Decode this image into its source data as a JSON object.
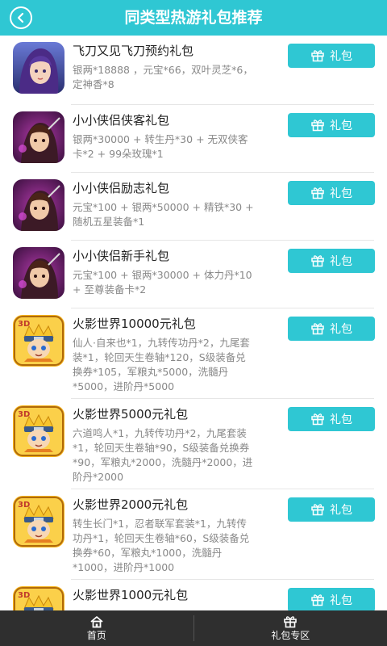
{
  "header": {
    "title": "同类型热游礼包推荐",
    "back_icon": "back-chevron-icon"
  },
  "button_label": "礼包",
  "items": [
    {
      "title": "飞刀又见飞刀预约礼包",
      "desc": "银两*18888 ，元宝*66，双叶灵芝*6，定神香*8",
      "icon": "game-icon-feidao"
    },
    {
      "title": "小小侠侣侠客礼包",
      "desc": "银两*30000 + 转生丹*30 + 无双侠客卡*2 + 99朵玫瑰*1",
      "icon": "game-icon-xiaoxiaoxialv"
    },
    {
      "title": "小小侠侣励志礼包",
      "desc": "元宝*100 + 银两*50000 + 精铁*30 + 随机五星装备*1",
      "icon": "game-icon-xiaoxiaoxialv"
    },
    {
      "title": "小小侠侣新手礼包",
      "desc": "元宝*100 + 银两*30000 + 体力丹*10 + 至尊装备卡*2",
      "icon": "game-icon-xiaoxiaoxialv"
    },
    {
      "title": "火影世界10000元礼包",
      "desc": "仙人·自来也*1，九转传功丹*2，九尾套装*1，轮回天生卷轴*120，S级装备兑换券*105，军粮丸*5000，洗髓丹*5000，进阶丹*5000",
      "icon": "game-icon-huoying"
    },
    {
      "title": "火影世界5000元礼包",
      "desc": "六道鸣人*1，九转传功丹*2，九尾套装*1，轮回天生卷轴*90，S级装备兑换券*90，军粮丸*2000，洗髓丹*2000，进阶丹*2000",
      "icon": "game-icon-huoying"
    },
    {
      "title": "火影世界2000元礼包",
      "desc": "转生长门*1，忍者联军套装*1，九转传功丹*1，轮回天生卷轴*60，S级装备兑换券*60，军粮丸*1000，洗髓丹*1000，进阶丹*1000",
      "icon": "game-icon-huoying"
    },
    {
      "title": "火影世界1000元礼包",
      "desc": "",
      "icon": "game-icon-huoying"
    }
  ],
  "bottom_nav": [
    {
      "label": "首页",
      "icon": "home-icon"
    },
    {
      "label": "礼包专区",
      "icon": "gift-icon"
    }
  ],
  "colors": {
    "accent": "#2fc7d3",
    "bottom_bar": "#2f2f2f"
  }
}
